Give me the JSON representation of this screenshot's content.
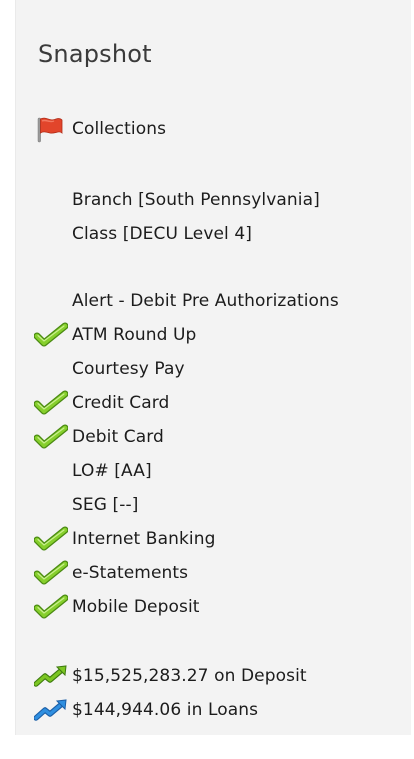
{
  "panel": {
    "title": "Snapshot"
  },
  "collections": {
    "icon": "red-flag-icon",
    "label": "Collections"
  },
  "info": [
    {
      "label": "Branch [South Pennsylvania]"
    },
    {
      "label": "Class [DECU Level 4]"
    }
  ],
  "services": [
    {
      "label": "Alert - Debit Pre Authorizations",
      "checked": false
    },
    {
      "label": "ATM Round Up",
      "checked": true
    },
    {
      "label": "Courtesy Pay",
      "checked": false
    },
    {
      "label": "Credit Card",
      "checked": true
    },
    {
      "label": "Debit Card",
      "checked": true
    },
    {
      "label": "LO# [AA]",
      "checked": false
    },
    {
      "label": "SEG [--]",
      "checked": false
    },
    {
      "label": "Internet Banking",
      "checked": true
    },
    {
      "label": "e-Statements",
      "checked": true
    },
    {
      "label": "Mobile Deposit",
      "checked": true
    }
  ],
  "totals": {
    "deposit": {
      "label": "$15,525,283.27 on Deposit",
      "icon": "green-trend-arrow-icon"
    },
    "loans": {
      "label": "$144,944.06 in Loans",
      "icon": "blue-trend-arrow-icon"
    }
  },
  "colors": {
    "check_green": "#7cc623",
    "check_dark": "#4a8a12",
    "flag_red": "#e2452b",
    "deposit_arrow": "#7cc623",
    "loans_arrow": "#2f8fe0"
  }
}
